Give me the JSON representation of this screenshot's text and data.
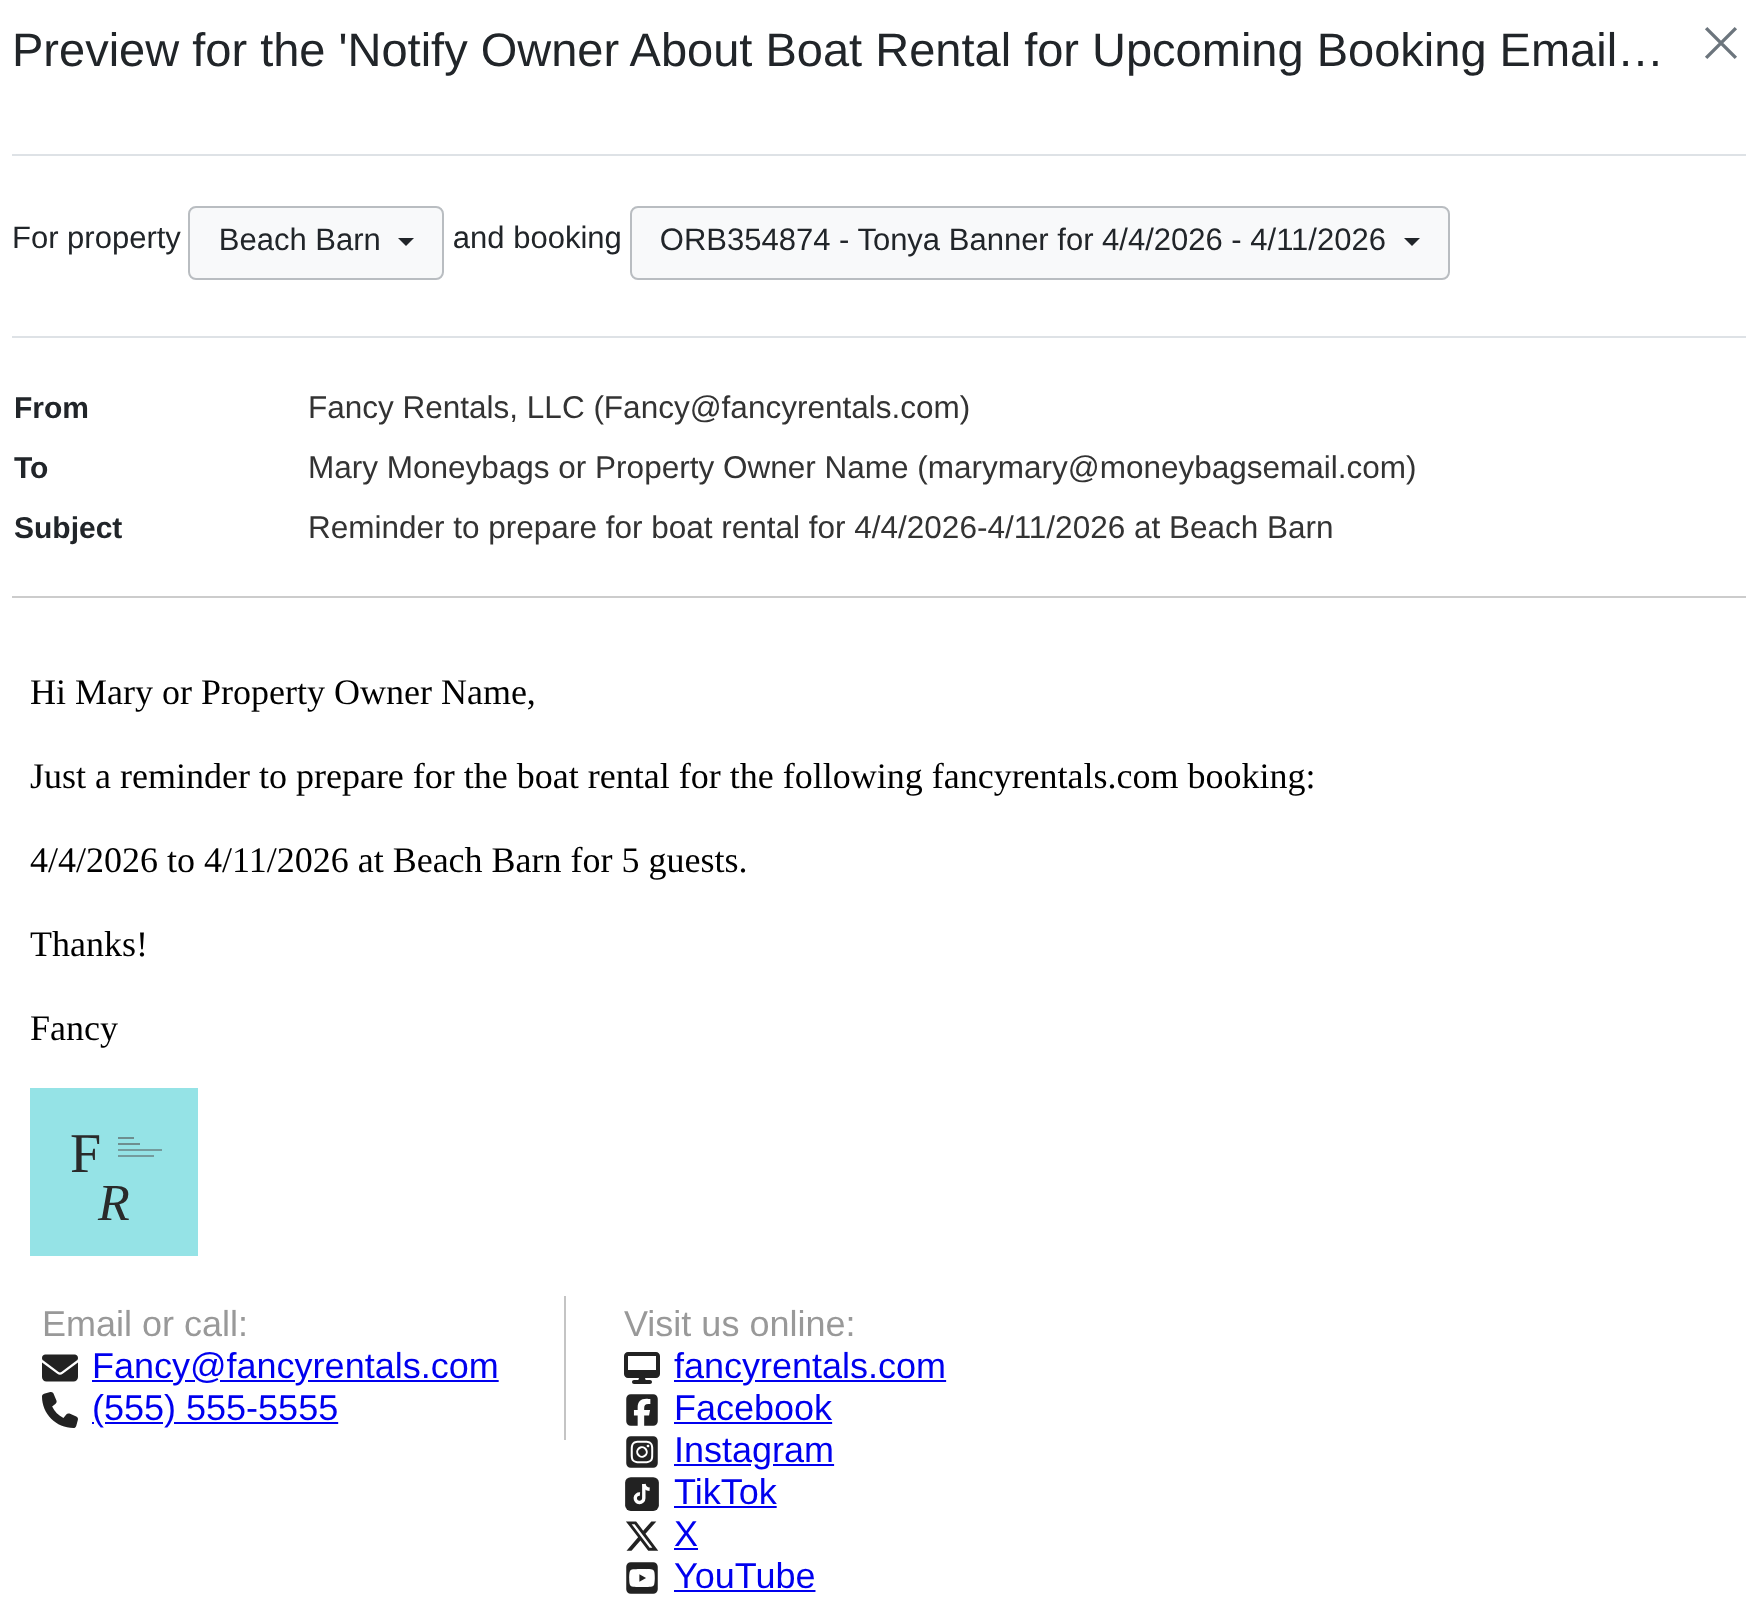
{
  "dialog": {
    "title": "Preview for the 'Notify Owner About Boat Rental for Upcoming Booking Email…"
  },
  "selectors": [
    {
      "label": "For property",
      "value": "Beach Barn"
    },
    {
      "label": "and booking",
      "value": "ORB354874 - Tonya Banner for 4/4/2026 - 4/11/2026"
    }
  ],
  "headers": [
    {
      "label": "From",
      "value": "Fancy Rentals, LLC (Fancy@fancyrentals.com)"
    },
    {
      "label": "To",
      "value": "Mary Moneybags or Property Owner Name (marymary@moneybagsemail.com)"
    },
    {
      "label": "Subject",
      "value": "Reminder to prepare for boat rental for 4/4/2026-4/11/2026 at Beach Barn"
    }
  ],
  "body": {
    "paragraphs": [
      "Hi Mary or Property Owner Name,",
      "Just a reminder to prepare for the boat rental for the following fancyrentals.com booking:",
      "4/4/2026 to 4/11/2026 at Beach Barn for 5 guests.",
      "Thanks!",
      "Fancy"
    ]
  },
  "logo": {
    "letters": [
      "F",
      "R"
    ]
  },
  "footer": {
    "columns": [
      {
        "heading": "Email or call:",
        "links": [
          {
            "kind": "email",
            "text": "Fancy@fancyrentals.com"
          },
          {
            "kind": "phone",
            "text": "(555) 555-5555"
          }
        ]
      },
      {
        "heading": "Visit us online:",
        "links": [
          {
            "kind": "website",
            "text": "fancyrentals.com"
          },
          {
            "kind": "facebook",
            "text": "Facebook"
          },
          {
            "kind": "instagram",
            "text": "Instagram"
          },
          {
            "kind": "tiktok",
            "text": "TikTok"
          },
          {
            "kind": "x",
            "text": "X"
          },
          {
            "kind": "youtube",
            "text": "YouTube"
          }
        ]
      }
    ]
  }
}
